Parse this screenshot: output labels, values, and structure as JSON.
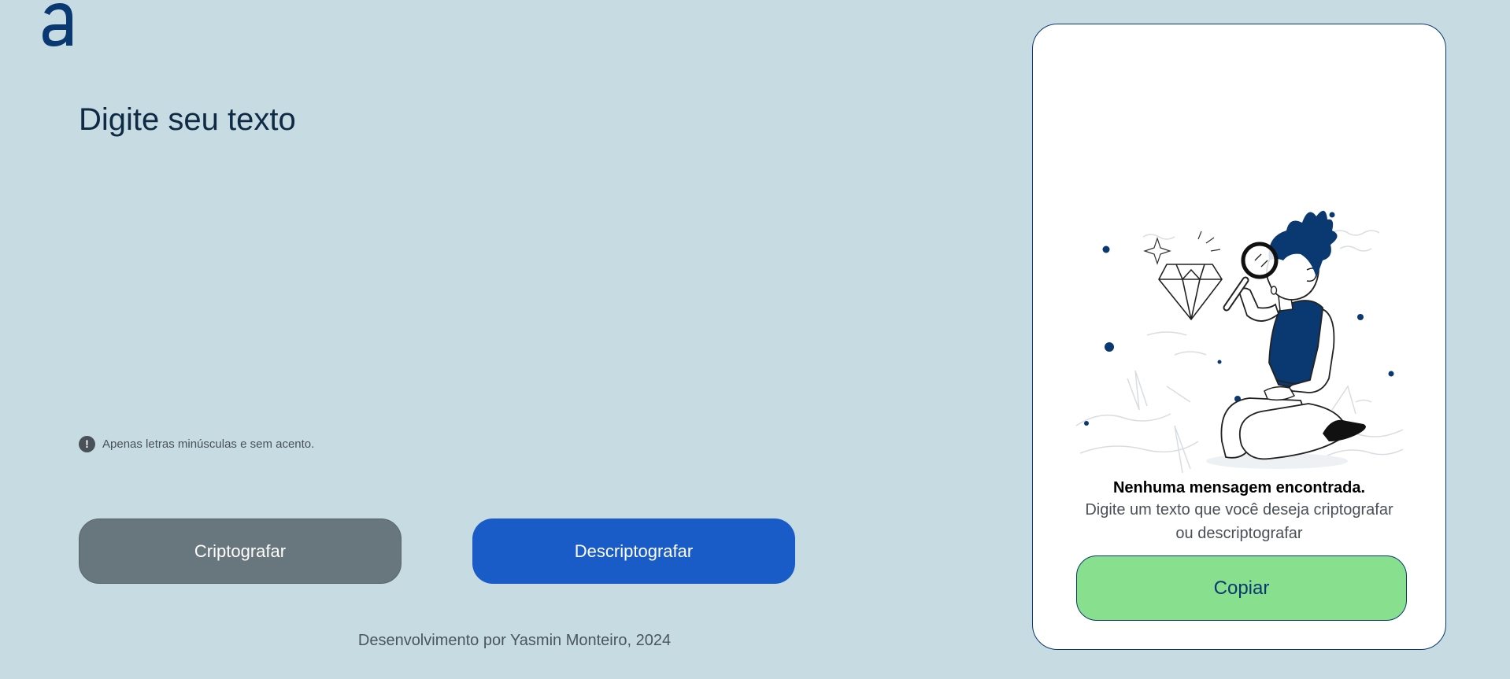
{
  "brand": {
    "logo_letter": "a",
    "logo_color": "#0a3871"
  },
  "editor": {
    "placeholder": "Digite seu texto",
    "value": ""
  },
  "hint": {
    "icon": "exclamation-circle-icon",
    "text": "Apenas letras minúsculas e sem acento."
  },
  "actions": {
    "encrypt_label": "Criptografar",
    "decrypt_label": "Descriptografar",
    "encrypt_color": "#68767e",
    "decrypt_color": "#1a5cc7"
  },
  "footer": {
    "text": "Desenvolvimento por Yasmin Monteiro, 2024"
  },
  "output_panel": {
    "illustration": "person-with-magnifying-glass-and-diamond",
    "title": "Nenhuma mensagem encontrada.",
    "subtitle": "Digite um texto que você deseja criptografar ou descriptografar",
    "copy_label": "Copiar",
    "copy_color": "#88e08f"
  }
}
